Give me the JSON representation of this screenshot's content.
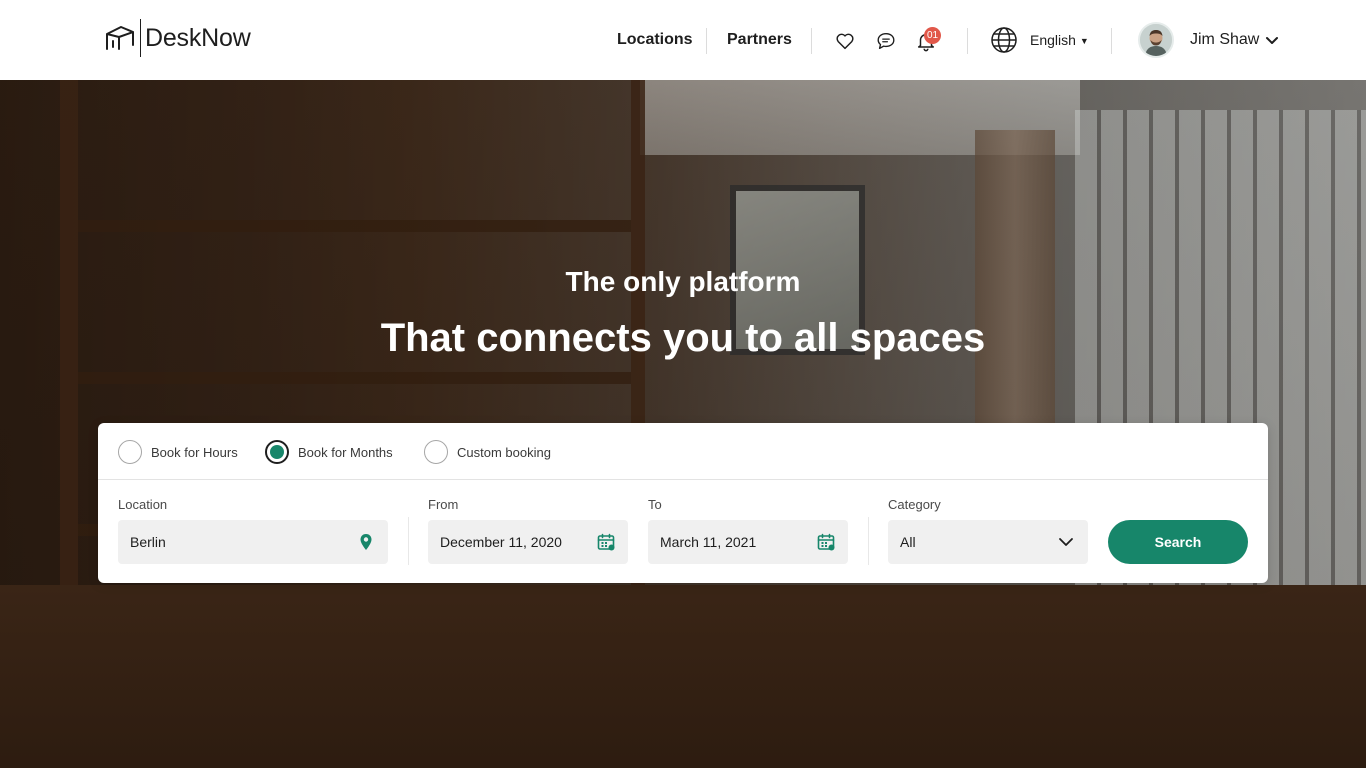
{
  "brand": {
    "name": "DeskNow"
  },
  "nav": {
    "links": [
      {
        "label": "Locations"
      },
      {
        "label": "Partners"
      }
    ],
    "icons": {
      "favorites": "heart-icon",
      "messages": "chat-bubble-icon",
      "notifications": "bell-icon"
    },
    "notification_count": "01",
    "language": {
      "icon": "globe-icon",
      "label": "English"
    },
    "user": {
      "name": "Jim Shaw"
    }
  },
  "hero": {
    "subtitle": "The only platform",
    "title": "That connects you to all spaces"
  },
  "search": {
    "booking_types": [
      {
        "label": "Book for Hours",
        "selected": false
      },
      {
        "label": "Book for Months",
        "selected": true
      },
      {
        "label": "Custom booking",
        "selected": false
      }
    ],
    "location": {
      "label": "Location",
      "value": "Berlin",
      "icon": "map-pin-icon"
    },
    "from": {
      "label": "From",
      "value": "December 11, 2020",
      "icon": "calendar-icon"
    },
    "to": {
      "label": "To",
      "value": "March 11, 2021",
      "icon": "calendar-icon"
    },
    "category": {
      "label": "Category",
      "value": "All"
    },
    "button_label": "Search"
  },
  "colors": {
    "accent": "#17866a",
    "badge": "#e1584a",
    "text": "#1e1e1e"
  }
}
